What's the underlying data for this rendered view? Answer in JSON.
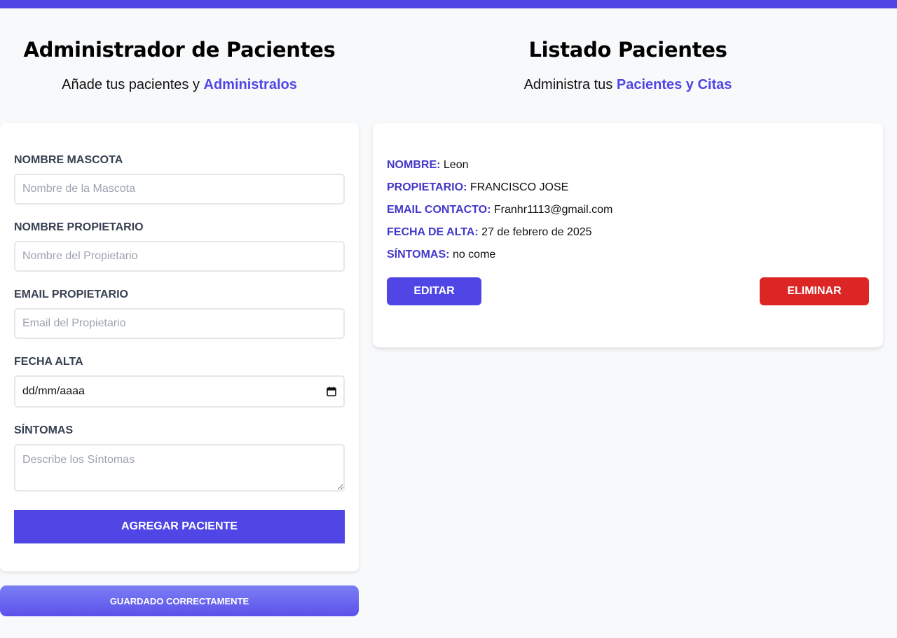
{
  "header": {
    "left_title": "Administrador de Pacientes",
    "left_subtitle_prefix": "Añade tus pacientes y ",
    "left_subtitle_accent": "Administralos",
    "right_title": "Listado Pacientes",
    "right_subtitle_prefix": "Administra tus ",
    "right_subtitle_accent": "Pacientes y Citas"
  },
  "form": {
    "pet_name": {
      "label": "Nombre Mascota",
      "value": "",
      "placeholder": "Nombre de la Mascota"
    },
    "owner_name": {
      "label": "Nombre Propietario",
      "value": "",
      "placeholder": "Nombre del Propietario"
    },
    "owner_email": {
      "label": "Email Propietario",
      "value": "",
      "placeholder": "Email del Propietario"
    },
    "date": {
      "label": "Fecha Alta",
      "value": "dd/mm/aaaa"
    },
    "symptoms": {
      "label": "Síntomas",
      "value": "",
      "placeholder": "Describe los Síntomas"
    },
    "submit_label": "Agregar Paciente"
  },
  "toast": {
    "message": "Guardado Correctamente"
  },
  "patients": [
    {
      "name_label": "Nombre:",
      "name": "Leon",
      "owner_label": "Propietario:",
      "owner": "FRANCISCO JOSE",
      "email_label": "Email Contacto:",
      "email": "Franhr1113@gmail.com",
      "date_label": "Fecha de Alta:",
      "date": "27 de febrero de 2025",
      "symptoms_label": "Síntomas:",
      "symptoms": "no come",
      "edit_label": "Editar",
      "delete_label": "Eliminar"
    }
  ],
  "colors": {
    "accent": "#4f46e5",
    "danger": "#dc2626",
    "label_accent": "#4338ca"
  },
  "icons": {
    "date_picker": "calendar-icon"
  }
}
